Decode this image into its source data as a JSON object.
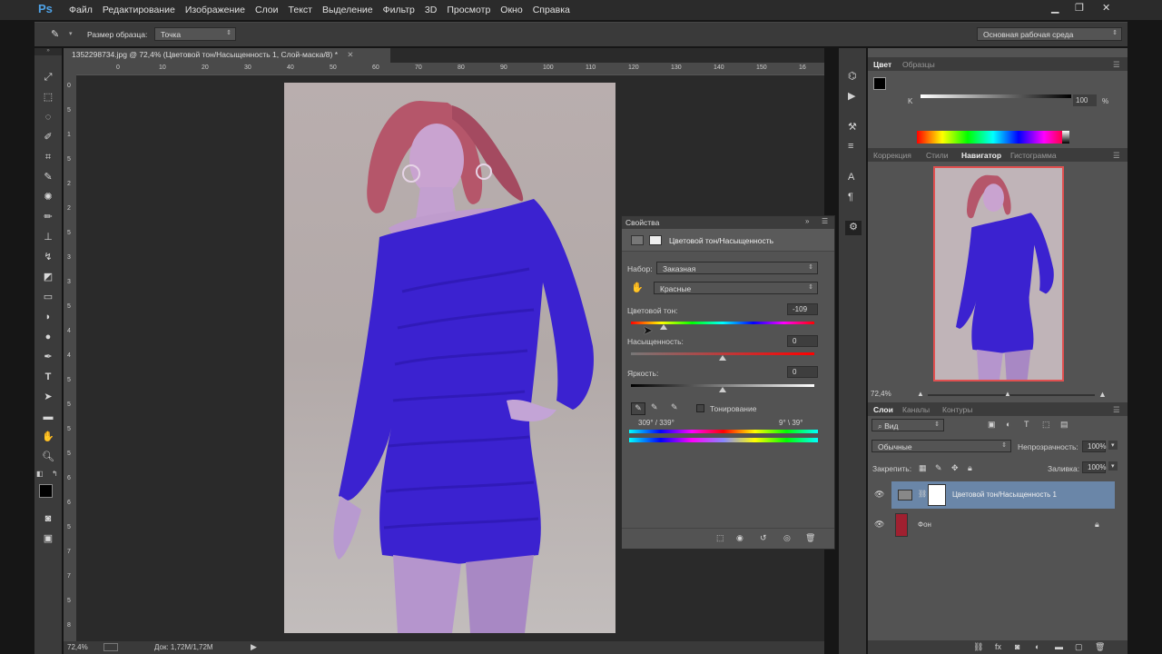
{
  "app": {
    "logo": "Ps",
    "menu": [
      "Файл",
      "Редактирование",
      "Изображение",
      "Слои",
      "Текст",
      "Выделение",
      "Фильтр",
      "3D",
      "Просмотр",
      "Окно",
      "Справка"
    ]
  },
  "options": {
    "sample_label": "Размер образца:",
    "sample_value": "Точка",
    "workspace": "Основная рабочая среда"
  },
  "document": {
    "tab_title": "1352298734.jpg @ 72,4% (Цветовой тон/Насыщенность 1, Слой-маска/8) *",
    "ruler_h_ticks": [
      "50",
      "60",
      "70",
      "80",
      "90",
      "100",
      "110",
      "120",
      "130",
      "140",
      "150",
      "160",
      "170",
      "180",
      "190",
      "200",
      "210",
      "220",
      "230",
      "240",
      "250",
      "260",
      "270",
      "280",
      "290",
      "300",
      "310",
      "320"
    ],
    "ruler_h_display": [
      "0",
      "10",
      "20",
      "30",
      "40",
      "50",
      "60",
      "70",
      "80",
      "90",
      "100",
      "110",
      "120",
      "130",
      "140",
      "150",
      "16"
    ],
    "ruler_v_ticks": [
      "0",
      "5",
      "1",
      "5",
      "2",
      "2",
      "5",
      "3",
      "3",
      "5",
      "4",
      "4",
      "5",
      "5",
      "5",
      "5",
      "6",
      "6",
      "5",
      "7",
      "7",
      "5",
      "8"
    ],
    "zoom": "72,4%",
    "doc_info": "Док: 1,72M/1,72M"
  },
  "properties": {
    "tab": "Свойства",
    "title": "Цветовой тон/Насыщенность",
    "preset_label": "Набор:",
    "preset_value": "Заказная",
    "channel_value": "Красные",
    "hue_label": "Цветовой тон:",
    "hue_value": "-109",
    "hue_level": 0.18,
    "saturation_label": "Насыщенность:",
    "saturation_value": "0",
    "saturation_level": 0.5,
    "lightness_label": "Яркость:",
    "lightness_value": "0",
    "lightness_level": 0.5,
    "colorize_label": "Тонирование",
    "range_left": "309° / 339°",
    "range_right": "9° \\ 39°"
  },
  "color_panel": {
    "tabs": [
      "Цвет",
      "Образцы"
    ],
    "channel_label": "K",
    "channel_value": "100",
    "percent": "%"
  },
  "navigator_panel": {
    "tabs": [
      "Коррекция",
      "Стили",
      "Навигатор",
      "Гистограмма"
    ],
    "zoom": "72,4%"
  },
  "layers_panel": {
    "tabs": [
      "Слои",
      "Каналы",
      "Контуры"
    ],
    "filter_value": "Вид",
    "blend_mode": "Обычные",
    "opacity_label": "Непрозрачность:",
    "opacity_value": "100%",
    "lock_label": "Закрепить:",
    "fill_label": "Заливка:",
    "fill_value": "100%",
    "layers": [
      {
        "name": "Цветовой тон/Насыщенность 1"
      },
      {
        "name": "Фон"
      }
    ]
  },
  "colors": {
    "accent_blue": "#4fa3e8",
    "dress": "#3b22d0",
    "selected_layer": "#6a86a8"
  }
}
